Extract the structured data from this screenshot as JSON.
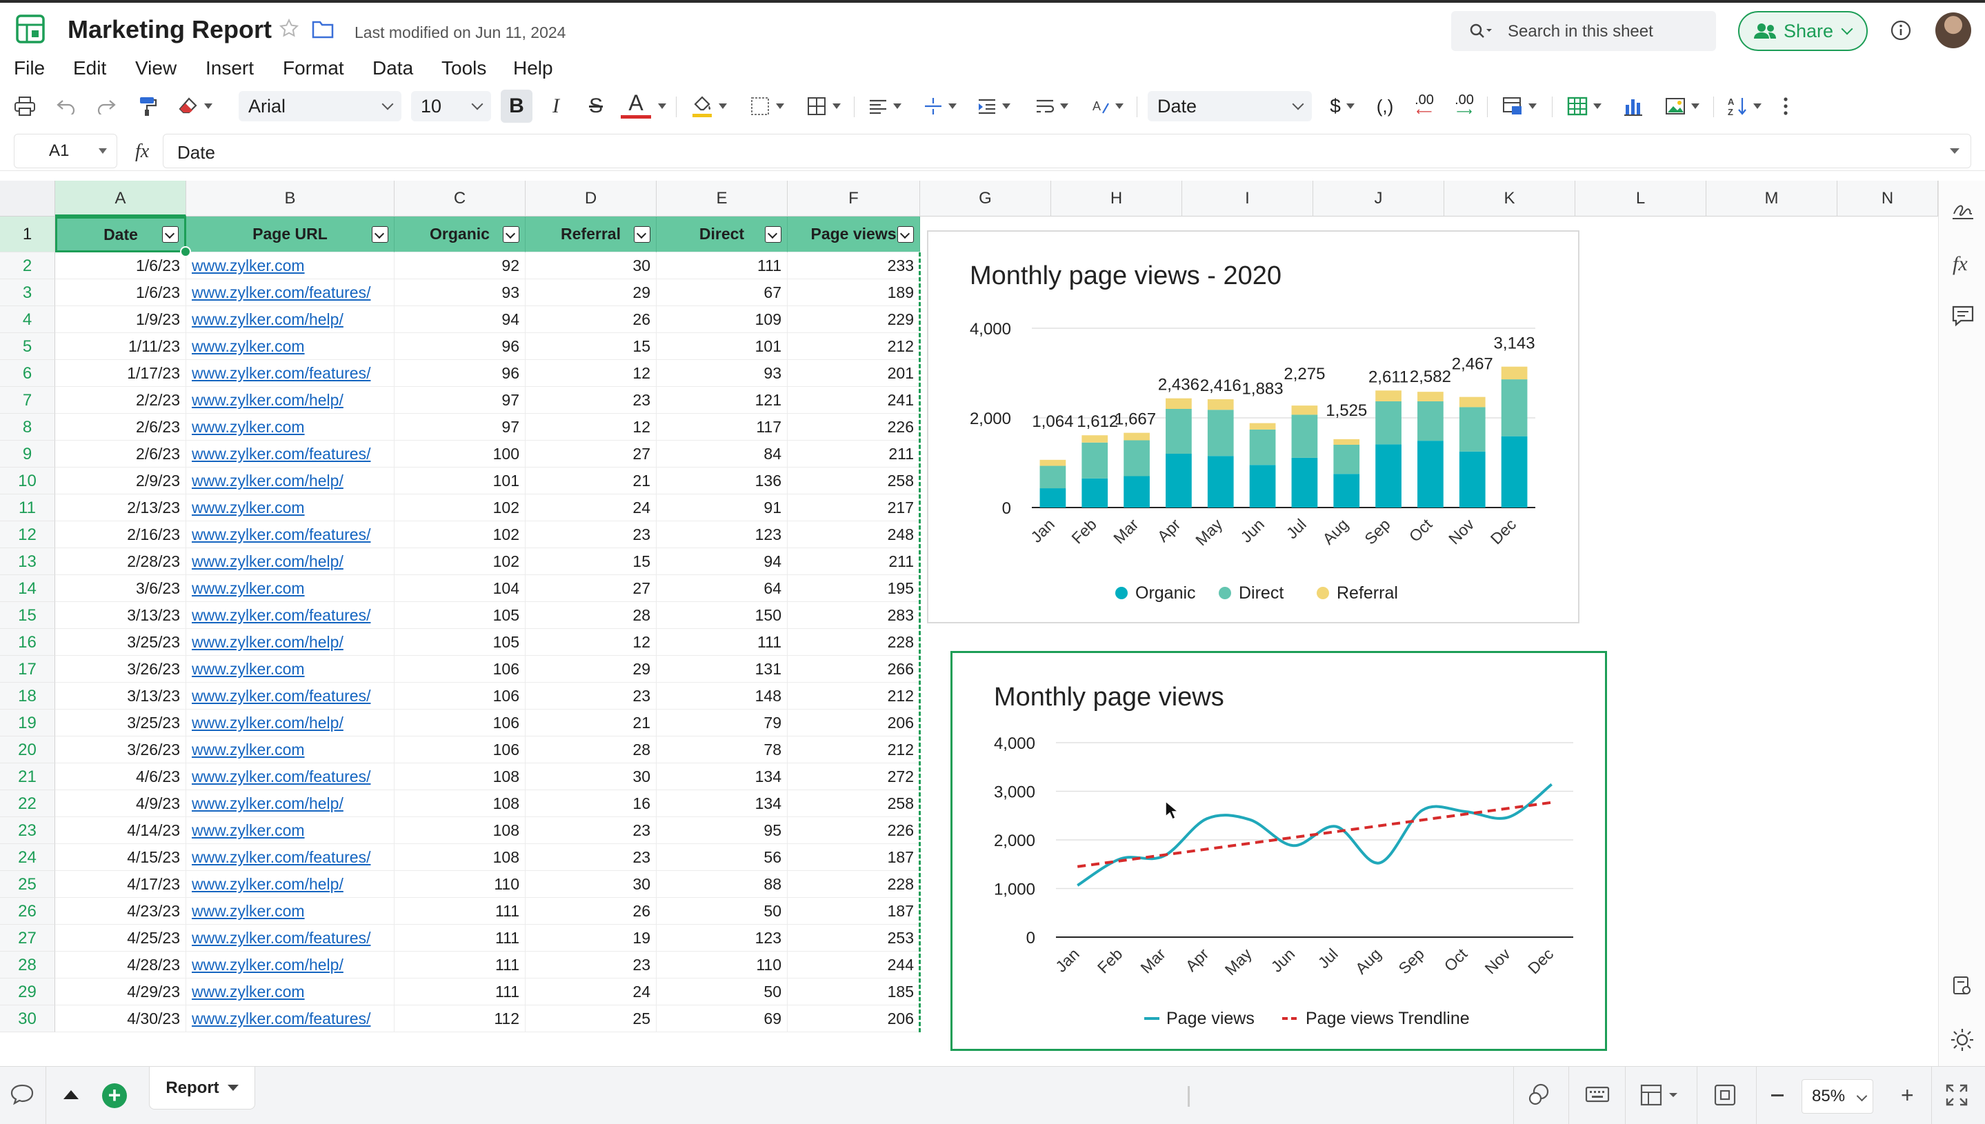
{
  "app": {
    "doc_title": "Marketing Report",
    "last_modified": "Last modified on Jun 11, 2024",
    "search_placeholder": "Search in this sheet",
    "share_label": "Share"
  },
  "menu": [
    "File",
    "Edit",
    "View",
    "Insert",
    "Format",
    "Data",
    "Tools",
    "Help"
  ],
  "toolbar": {
    "font_family": "Arial",
    "font_size": "10",
    "number_format": "Date",
    "currency_symbol": "$",
    "comma_label": "(,)",
    "decimal_decrease": ".00",
    "decimal_increase": ".00",
    "bold_label": "B",
    "italic_label": "I",
    "strike_label": "S",
    "textcolor_label": "A"
  },
  "formula_bar": {
    "cell_ref": "A1",
    "fx_label": "fx",
    "value": "Date"
  },
  "columns": [
    "A",
    "B",
    "C",
    "D",
    "E",
    "F",
    "G",
    "H",
    "I",
    "J",
    "K",
    "L",
    "M",
    "N"
  ],
  "table": {
    "headers": [
      "Date",
      "Page URL",
      "Organic",
      "Referral",
      "Direct",
      "Page views"
    ],
    "rows": [
      [
        "1/6/23",
        "www.zylker.com",
        "92",
        "30",
        "111",
        "233"
      ],
      [
        "1/6/23",
        "www.zylker.com/features/",
        "93",
        "29",
        "67",
        "189"
      ],
      [
        "1/9/23",
        "www.zylker.com/help/",
        "94",
        "26",
        "109",
        "229"
      ],
      [
        "1/11/23",
        "www.zylker.com",
        "96",
        "15",
        "101",
        "212"
      ],
      [
        "1/17/23",
        "www.zylker.com/features/",
        "96",
        "12",
        "93",
        "201"
      ],
      [
        "2/2/23",
        "www.zylker.com/help/",
        "97",
        "23",
        "121",
        "241"
      ],
      [
        "2/6/23",
        "www.zylker.com",
        "97",
        "12",
        "117",
        "226"
      ],
      [
        "2/6/23",
        "www.zylker.com/features/",
        "100",
        "27",
        "84",
        "211"
      ],
      [
        "2/9/23",
        "www.zylker.com/help/",
        "101",
        "21",
        "136",
        "258"
      ],
      [
        "2/13/23",
        "www.zylker.com",
        "102",
        "24",
        "91",
        "217"
      ],
      [
        "2/16/23",
        "www.zylker.com/features/",
        "102",
        "23",
        "123",
        "248"
      ],
      [
        "2/28/23",
        "www.zylker.com/help/",
        "102",
        "15",
        "94",
        "211"
      ],
      [
        "3/6/23",
        "www.zylker.com",
        "104",
        "27",
        "64",
        "195"
      ],
      [
        "3/13/23",
        "www.zylker.com/features/",
        "105",
        "28",
        "150",
        "283"
      ],
      [
        "3/25/23",
        "www.zylker.com/help/",
        "105",
        "12",
        "111",
        "228"
      ],
      [
        "3/26/23",
        "www.zylker.com",
        "106",
        "29",
        "131",
        "266"
      ],
      [
        "3/13/23",
        "www.zylker.com/features/",
        "106",
        "23",
        "148",
        "212"
      ],
      [
        "3/25/23",
        "www.zylker.com/help/",
        "106",
        "21",
        "79",
        "206"
      ],
      [
        "3/26/23",
        "www.zylker.com",
        "106",
        "28",
        "78",
        "212"
      ],
      [
        "4/6/23",
        "www.zylker.com/features/",
        "108",
        "30",
        "134",
        "272"
      ],
      [
        "4/9/23",
        "www.zylker.com/help/",
        "108",
        "16",
        "134",
        "258"
      ],
      [
        "4/14/23",
        "www.zylker.com",
        "108",
        "23",
        "95",
        "226"
      ],
      [
        "4/15/23",
        "www.zylker.com/features/",
        "108",
        "23",
        "56",
        "187"
      ],
      [
        "4/17/23",
        "www.zylker.com/help/",
        "110",
        "30",
        "88",
        "228"
      ],
      [
        "4/23/23",
        "www.zylker.com",
        "111",
        "26",
        "50",
        "187"
      ],
      [
        "4/25/23",
        "www.zylker.com/features/",
        "111",
        "19",
        "123",
        "253"
      ],
      [
        "4/28/23",
        "www.zylker.com/help/",
        "111",
        "23",
        "110",
        "244"
      ],
      [
        "4/29/23",
        "www.zylker.com",
        "111",
        "24",
        "50",
        "185"
      ],
      [
        "4/30/23",
        "www.zylker.com/features/",
        "112",
        "25",
        "69",
        "206"
      ]
    ]
  },
  "colors": {
    "organic": "#00aec0",
    "direct": "#63c5b0",
    "referral": "#f2d676",
    "line": "#20a8ba",
    "trend": "#d62b2b",
    "accent": "#1d9e57"
  },
  "chart_data": [
    {
      "type": "bar",
      "stacked": true,
      "title": "Monthly page views - 2020",
      "categories": [
        "Jan",
        "Feb",
        "Mar",
        "Apr",
        "May",
        "Jun",
        "Jul",
        "Aug",
        "Sep",
        "Oct",
        "Nov",
        "Dec"
      ],
      "series": [
        {
          "name": "Organic",
          "values": [
            430,
            650,
            700,
            1200,
            1150,
            950,
            1110,
            750,
            1410,
            1490,
            1250,
            1590
          ]
        },
        {
          "name": "Direct",
          "values": [
            500,
            800,
            800,
            1000,
            1030,
            790,
            960,
            650,
            960,
            880,
            990,
            1270
          ]
        },
        {
          "name": "Referral",
          "values": [
            134,
            162,
            167,
            236,
            236,
            143,
            205,
            125,
            241,
            212,
            227,
            283
          ]
        }
      ],
      "totals": [
        1064,
        1612,
        1667,
        2436,
        2416,
        1883,
        2275,
        1525,
        2611,
        2582,
        2467,
        3143
      ],
      "ylim": [
        0,
        4000
      ],
      "yticks": [
        "0",
        "2,000",
        "4,000"
      ],
      "legend": "bottom"
    },
    {
      "type": "line",
      "title": "Monthly page views",
      "categories": [
        "Jan",
        "Feb",
        "Mar",
        "Apr",
        "May",
        "Jun",
        "Jul",
        "Aug",
        "Sep",
        "Oct",
        "Nov",
        "Dec"
      ],
      "series": [
        {
          "name": "Page views",
          "values": [
            1064,
            1612,
            1667,
            2436,
            2416,
            1883,
            2275,
            1525,
            2611,
            2582,
            2467,
            3143
          ]
        },
        {
          "name": "Page views Trendline",
          "values": [
            1450,
            1570,
            1690,
            1810,
            1930,
            2050,
            2170,
            2290,
            2410,
            2530,
            2650,
            2770
          ],
          "style": "dashed"
        }
      ],
      "ylim": [
        0,
        4000
      ],
      "yticks": [
        "0",
        "1,000",
        "2,000",
        "3,000",
        "4,000"
      ],
      "legend": "bottom"
    }
  ],
  "sheet_tab": "Report",
  "status": {
    "zoom": "85%"
  }
}
